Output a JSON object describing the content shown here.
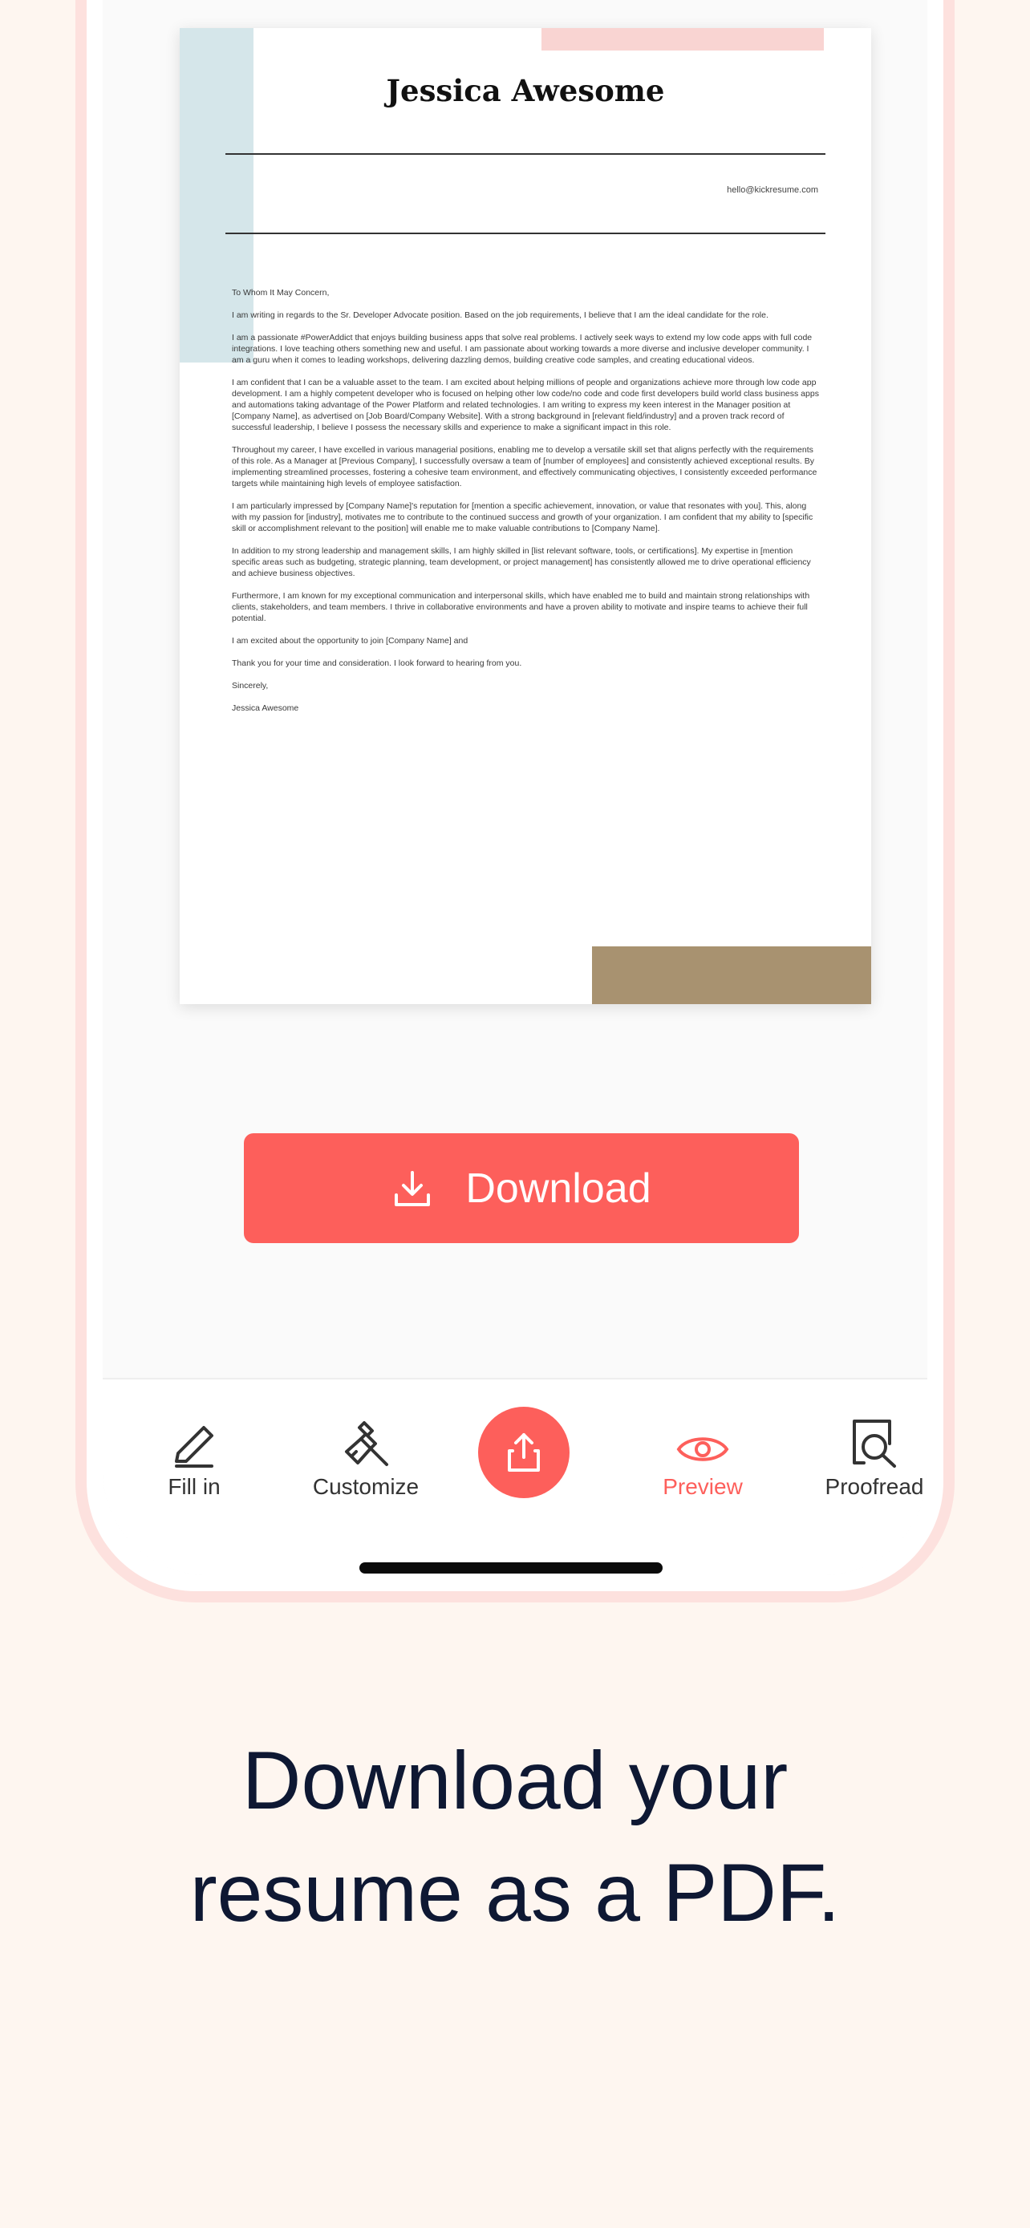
{
  "document": {
    "name": "Jessica Awesome",
    "email": "hello@kickresume.com",
    "paragraphs": [
      "To Whom It May Concern,",
      "I am writing in regards to the Sr. Developer Advocate position. Based on the job requirements, I believe that I am the ideal candidate for the role.",
      "I am a passionate #PowerAddict that enjoys building business apps that solve real problems. I actively seek ways to extend my low code apps with full code integrations. I love teaching others something new and useful. I am passionate about working towards a more diverse and inclusive developer community. I am a guru when it comes to leading workshops, delivering dazzling demos, building creative code samples, and creating educational videos.",
      "I am confident that I can be a valuable asset to the team. I am excited about helping millions of people and organizations achieve more through low code app development. I am a highly competent developer who is focused on helping other low code/no code and code first developers build world class business apps and automations taking advantage of the Power Platform and related technologies. I am writing to express my keen interest in the Manager position at [Company Name], as advertised on [Job Board/Company Website]. With a strong background in [relevant field/industry] and a proven track record of successful leadership, I believe I possess the necessary skills and experience to make a significant impact in this role.",
      "Throughout my career, I have excelled in various managerial positions, enabling me to develop a versatile skill set that aligns perfectly with the requirements of this role. As a Manager at [Previous Company], I successfully oversaw a team of [number of employees] and consistently achieved exceptional results. By implementing streamlined processes, fostering a cohesive team environment, and effectively communicating objectives, I consistently exceeded performance targets while maintaining high levels of employee satisfaction.",
      "I am particularly impressed by [Company Name]'s reputation for [mention a specific achievement, innovation, or value that resonates with you]. This, along with my passion for [industry], motivates me to contribute to the continued success and growth of your organization. I am confident that my ability to [specific skill or accomplishment relevant to the position] will enable me to make valuable contributions to [Company Name].",
      "In addition to my strong leadership and management skills, I am highly skilled in [list relevant software, tools, or certifications]. My expertise in [mention specific areas such as budgeting, strategic planning, team development, or project management] has consistently allowed me to drive operational efficiency and achieve business objectives.",
      "Furthermore, I am known for my exceptional communication and interpersonal skills, which have enabled me to build and maintain strong relationships with clients, stakeholders, and team members. I thrive in collaborative environments and have a proven ability to motivate and inspire teams to achieve their full potential.",
      "I am excited about the opportunity to join [Company Name] and",
      "Thank you for your time and consideration. I look forward to hearing from you.",
      "Sincerely,",
      "Jessica Awesome"
    ]
  },
  "download_label": "Download",
  "tabs": [
    {
      "label": "Fill in",
      "icon": "pencil-icon"
    },
    {
      "label": "Customize",
      "icon": "paint-brush-icon"
    },
    {
      "label": "Preview",
      "icon": "eye-icon",
      "active": true
    },
    {
      "label": "Proofread",
      "icon": "magnifier-document-icon"
    }
  ],
  "share_icon": "share-upload-icon",
  "headline": {
    "line1": "Download your",
    "line2": "resume as a PDF."
  },
  "colors": {
    "accent": "#fd5f5b",
    "background": "#fef6f0",
    "phone_frame": "#fde1de",
    "headline": "#0e1833"
  }
}
